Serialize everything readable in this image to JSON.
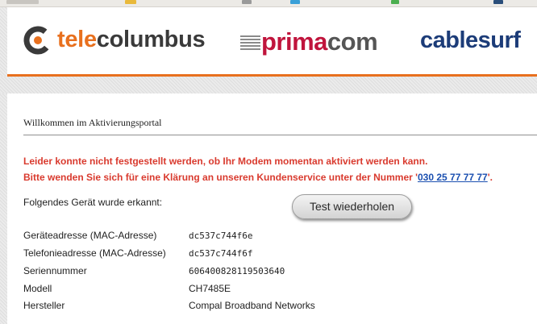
{
  "brands": {
    "telecolumbus": {
      "part1": "tele",
      "part2": "columbus"
    },
    "primacom": {
      "part1": "prima",
      "part2": "com"
    },
    "cablesurf": "cablesurf"
  },
  "page": {
    "welcome": "Willkommen im Aktivierungsportal",
    "error_line1": "Leider konnte nicht festgestellt werden, ob Ihr Modem momentan aktiviert werden kann.",
    "error_line2_prefix": "Bitte wenden Sie sich für eine Klärung an unseren Kundenservice unter der Nummer '",
    "error_phone": "030 25 77 77 77",
    "error_line2_suffix": "'.",
    "detected_label": "Folgendes Gerät wurde erkannt:",
    "retry_button": "Test wiederholen"
  },
  "device": [
    {
      "label": "Geräteadresse (MAC-Adresse)",
      "value": "dc537c744f6e"
    },
    {
      "label": "Telefonieadresse (MAC-Adresse)",
      "value": "dc537c744f6f"
    },
    {
      "label": "Seriennummer",
      "value": "606400828119503640"
    },
    {
      "label": "Modell",
      "value": "CH7485E"
    },
    {
      "label": "Hersteller",
      "value": "Compal Broadband Networks"
    }
  ],
  "colors": {
    "brand_orange": "#e8701e",
    "primacom_red": "#c0143c",
    "cablesurf_blue": "#1c3c78",
    "error_red": "#d93a2e",
    "link_blue": "#1a4fb0"
  }
}
